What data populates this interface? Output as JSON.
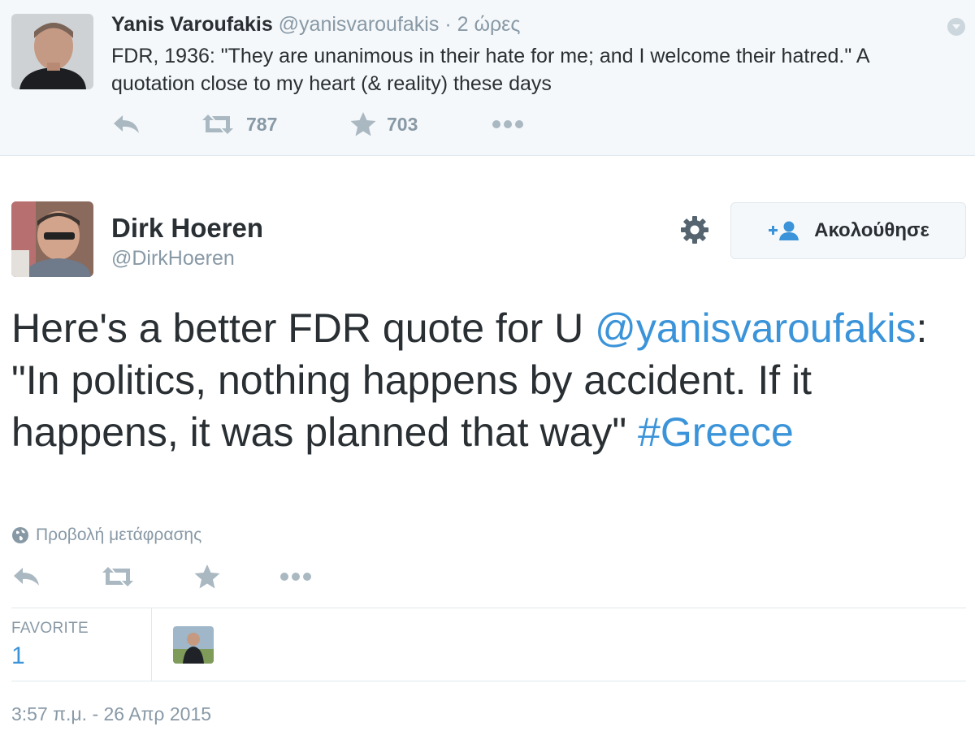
{
  "parent_tweet": {
    "name": "Yanis Varoufakis",
    "handle": "@yanisvaroufakis",
    "separator": "·",
    "time": "2 ώρες",
    "text": "FDR, 1936: \"They are unanimous in their hate for me; and I welcome their hatred.\" A quotation close to my heart (& reality) these days",
    "retweets": "787",
    "favorites": "703",
    "avatar_icon": "user-avatar-photo"
  },
  "main_tweet": {
    "name": "Dirk Hoeren",
    "handle": "@DirkHoeren",
    "follow_label": "Ακολούθησε",
    "text_before": "Here's a better FDR quote for U ",
    "mention": "@yanisvaroufakis",
    "text_middle": ": \"In politics, nothing happens by accident. If it happens, it was planned that way\" ",
    "hashtag": "#Greece",
    "translate_label": "Προβολή μετάφρασης",
    "stat_label": "FAVORITE",
    "stat_value": "1",
    "timestamp": "3:57 π.μ. - 26 Απρ 2015"
  },
  "colors": {
    "link": "#3b94d9",
    "text": "#292f33",
    "muted": "#8899a6",
    "icon": "#aab8c2",
    "parent_bg": "#f5f8fa",
    "border": "#e1e8ed"
  }
}
